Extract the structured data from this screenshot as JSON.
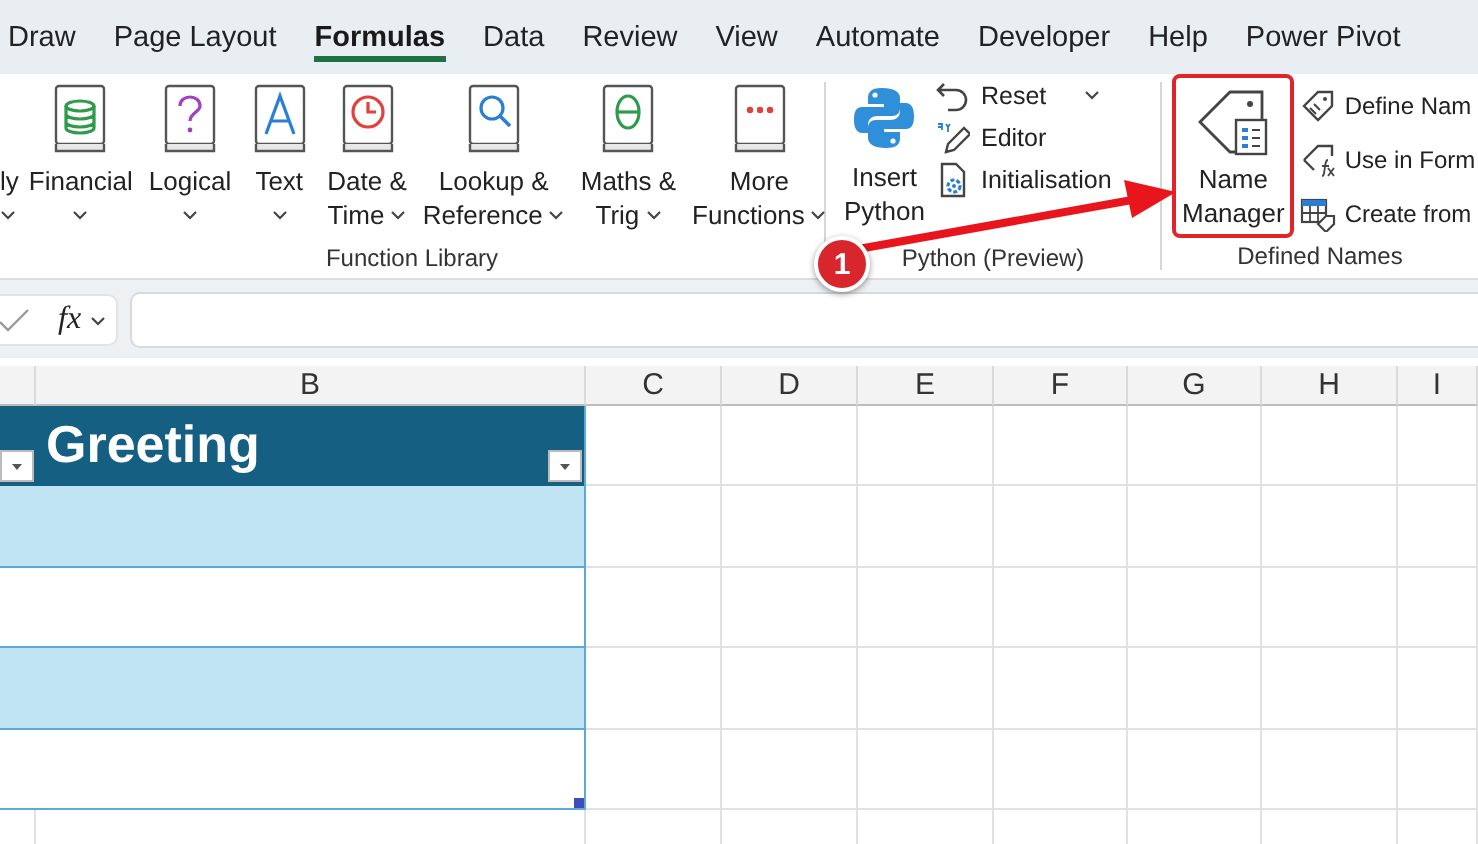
{
  "ribbon_tabs": [
    {
      "label": "Draw",
      "selected": false
    },
    {
      "label": "Page Layout",
      "selected": false
    },
    {
      "label": "Formulas",
      "selected": true
    },
    {
      "label": "Data",
      "selected": false
    },
    {
      "label": "Review",
      "selected": false
    },
    {
      "label": "View",
      "selected": false
    },
    {
      "label": "Automate",
      "selected": false
    },
    {
      "label": "Developer",
      "selected": false
    },
    {
      "label": "Help",
      "selected": false
    },
    {
      "label": "Power Pivot",
      "selected": false
    }
  ],
  "function_library": {
    "label": "Function Library",
    "buttons": [
      {
        "kind": "partial",
        "lines": [
          "ly"
        ],
        "dropdown": true
      },
      {
        "kind": "database",
        "lines": [
          "Financial"
        ],
        "dropdown": true
      },
      {
        "kind": "question",
        "lines": [
          "Logical"
        ],
        "dropdown": true
      },
      {
        "kind": "letter",
        "lines": [
          "Text"
        ],
        "dropdown": true
      },
      {
        "kind": "clock",
        "lines": [
          "Date &",
          "Time"
        ],
        "dropdown": true
      },
      {
        "kind": "magnifier",
        "lines": [
          "Lookup &",
          "Reference"
        ],
        "dropdown": true
      },
      {
        "kind": "theta",
        "lines": [
          "Maths &",
          "Trig"
        ],
        "dropdown": true
      },
      {
        "kind": "dots",
        "lines": [
          "More",
          "Functions"
        ],
        "dropdown": true
      }
    ]
  },
  "python": {
    "label": "Python (Preview)",
    "insert": {
      "lines": [
        "Insert",
        "Python"
      ]
    },
    "commands": [
      {
        "kind": "undo",
        "label": "Reset",
        "dropdown": true
      },
      {
        "kind": "pen",
        "label": "Editor",
        "dropdown": false
      },
      {
        "kind": "gear-doc",
        "label": "Initialisation",
        "dropdown": false
      }
    ]
  },
  "defined_names": {
    "label": "Defined Names",
    "manager": {
      "lines": [
        "Name",
        "Manager"
      ],
      "highlighted": true
    },
    "commands": [
      {
        "kind": "tag",
        "label": "Define Nam"
      },
      {
        "kind": "tag-fx",
        "label": "Use in Form"
      },
      {
        "kind": "table-tag",
        "label": "Create from"
      }
    ]
  },
  "formula_bar": {
    "function_label": "fx"
  },
  "sheet": {
    "columns": [
      "B",
      "C",
      "D",
      "E",
      "F",
      "G",
      "H",
      "I"
    ],
    "table": {
      "header": "Greeting",
      "rows": [
        {
          "shaded": true
        },
        {
          "shaded": false
        },
        {
          "shaded": true
        },
        {
          "shaded": false
        }
      ]
    }
  },
  "callout": {
    "badge": "1"
  }
}
